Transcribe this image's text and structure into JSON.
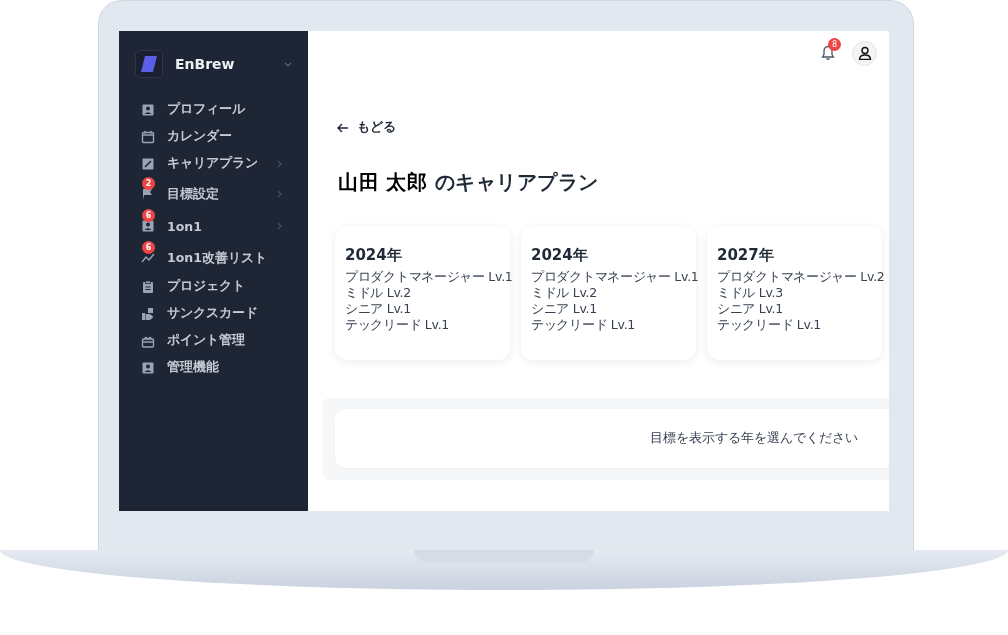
{
  "brand": {
    "name": "EnBrew"
  },
  "sidebar": {
    "items": [
      {
        "label": "プロフィール",
        "expandable": false
      },
      {
        "label": "カレンダー",
        "expandable": false
      },
      {
        "label": "キャリアプラン",
        "expandable": true
      },
      {
        "label": "目標設定",
        "expandable": true,
        "badge": "2"
      },
      {
        "label": "1on1",
        "expandable": true,
        "badge": "6"
      },
      {
        "label": "1on1改善リスト",
        "expandable": false,
        "badge": "6"
      },
      {
        "label": "プロジェクト",
        "expandable": false
      },
      {
        "label": "サンクスカード",
        "expandable": false
      },
      {
        "label": "ポイント管理",
        "expandable": false
      },
      {
        "label": "管理機能",
        "expandable": false
      }
    ]
  },
  "header": {
    "notification_count": "8"
  },
  "back_link": "もどる",
  "title": "**山田 太郎** のキャリアプラン",
  "plans": [
    {
      "year": "2024年",
      "levels": [
        "プロダクトマネージャー Lv.1",
        "ミドル Lv.2",
        "シニア Lv.1",
        "テックリード Lv.1"
      ]
    },
    {
      "year": "2024年",
      "levels": [
        "プロダクトマネージャー Lv.1",
        "ミドル Lv.2",
        "シニア Lv.1",
        "テックリード Lv.1"
      ]
    },
    {
      "year": "2027年",
      "levels": [
        "プロダクトマネージャー Lv.2",
        "ミドル Lv.3",
        "シニア Lv.1",
        "テックリード Lv.1"
      ]
    }
  ],
  "goals_panel": {
    "message": "目標を表示する年を選んでください"
  }
}
